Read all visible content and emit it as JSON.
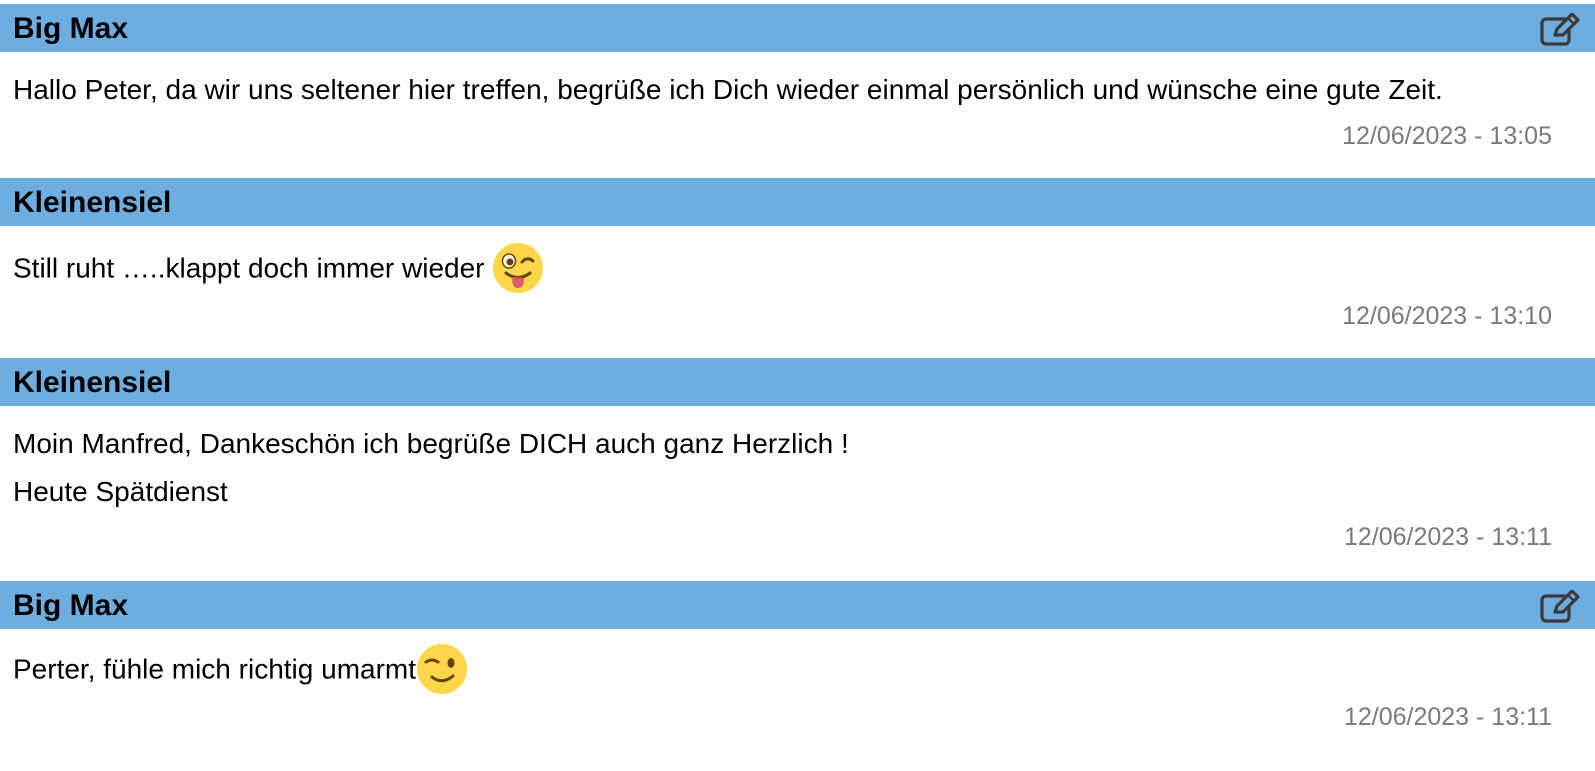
{
  "posts": [
    {
      "author": "Big Max",
      "editable": true,
      "lines": [
        "Hallo Peter, da wir uns seltener hier treffen, begrüße ich Dich wieder einmal persönlich und wünsche eine gute Zeit."
      ],
      "emoji": null,
      "timestamp": "12/06/2023 - 13:05"
    },
    {
      "author": "Kleinensiel",
      "editable": false,
      "lines": [
        "Still ruht …..klappt doch immer wieder "
      ],
      "emoji": "winking-face-with-tongue-icon",
      "timestamp": "12/06/2023 - 13:10"
    },
    {
      "author": "Kleinensiel",
      "editable": false,
      "lines": [
        "Moin Manfred, Dankeschön ich begrüße DICH auch ganz Herzlich !",
        "Heute Spätdienst"
      ],
      "emoji": null,
      "timestamp": "12/06/2023 - 13:11"
    },
    {
      "author": "Big Max",
      "editable": true,
      "lines": [
        "Perter, fühle mich richtig umarmt"
      ],
      "emoji": "winking-face-icon",
      "timestamp": "12/06/2023 - 13:11"
    }
  ],
  "colors": {
    "header_bg": "#6eaddf",
    "timestamp": "#7a7a7a",
    "emoji_face": "#fdd64a"
  }
}
